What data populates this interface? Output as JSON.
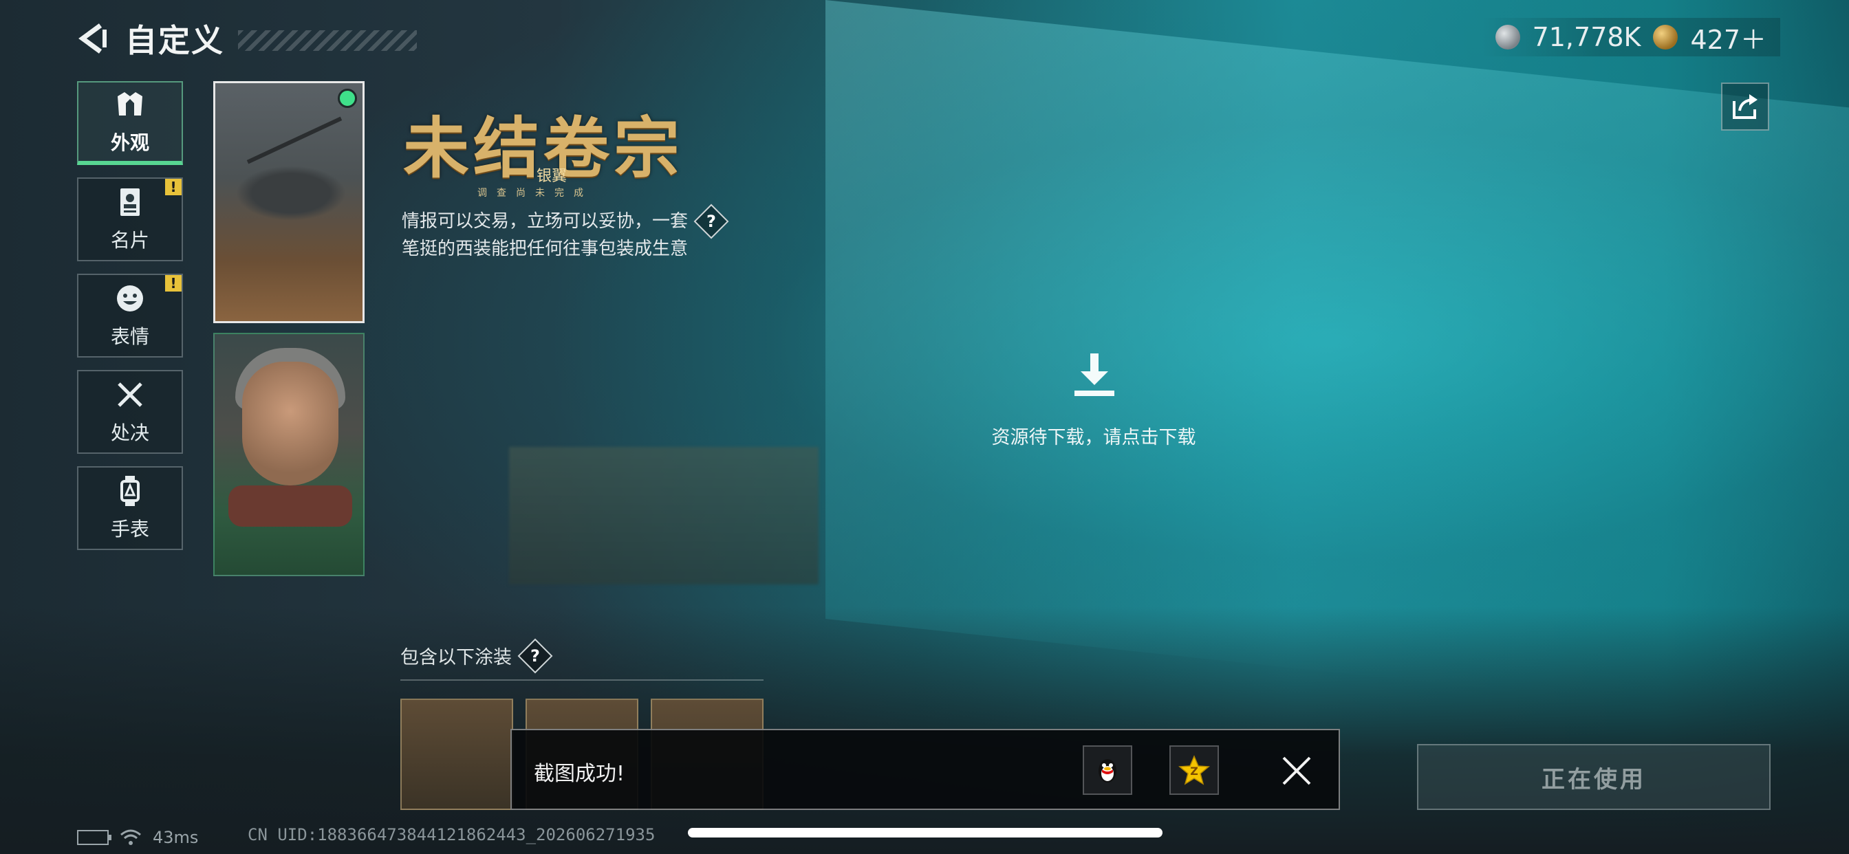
{
  "header": {
    "title": "自定义"
  },
  "currency": {
    "silver_amount": "71,778K",
    "gold_amount": "427＋"
  },
  "sidebar": {
    "items": [
      {
        "label": "外观",
        "active": true,
        "badge": ""
      },
      {
        "label": "名片",
        "active": false,
        "badge": "!"
      },
      {
        "label": "表情",
        "active": false,
        "badge": "!"
      },
      {
        "label": "处决",
        "active": false,
        "badge": ""
      },
      {
        "label": "手表",
        "active": false,
        "badge": ""
      }
    ]
  },
  "item": {
    "logo_text": "未结卷宗",
    "logo_sub": "银翼",
    "logo_dots": "调查尚未完成",
    "description": "情报可以交易，立场可以妥协，一套笔挺的西装能把任何往事包装成生意",
    "help_symbol": "?"
  },
  "preview": {
    "download_text": "资源待下载，请点击下载"
  },
  "includes": {
    "title": "包含以下涂装",
    "help_symbol": "?"
  },
  "toast": {
    "message": "截图成功!"
  },
  "actions": {
    "in_use_label": "正在使用"
  },
  "status_bar": {
    "ping": "43ms",
    "uid": "CN UID:1883664738441218624​43_202606271935"
  },
  "colors": {
    "accent_green": "#58d692",
    "gold": "#d8b26a",
    "badge_yellow": "#e8c23a"
  }
}
